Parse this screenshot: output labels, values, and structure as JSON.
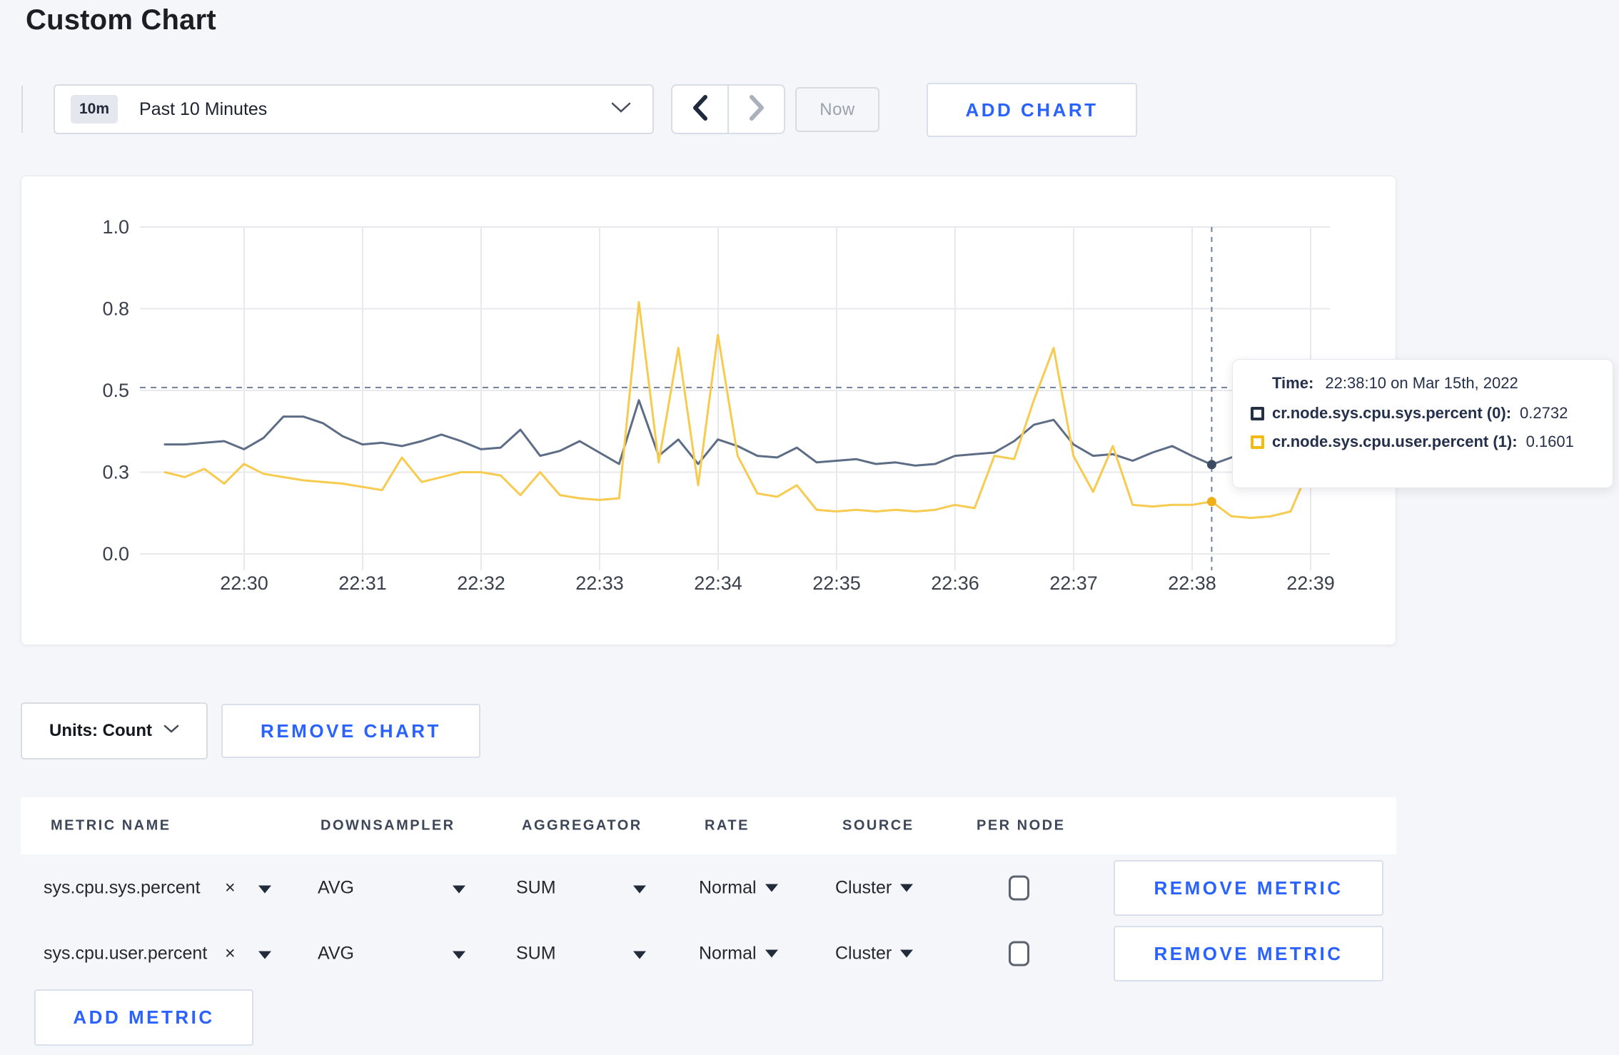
{
  "page": {
    "title": "Custom Chart"
  },
  "toolbar": {
    "time_badge": "10m",
    "time_range_label": "Past 10 Minutes",
    "now_label": "Now",
    "add_chart_label": "ADD CHART"
  },
  "chart_data": {
    "type": "line",
    "title": "",
    "x_start": "22:29:20",
    "x_interval_seconds": 10,
    "x_tick_labels": [
      "22:30",
      "22:31",
      "22:32",
      "22:33",
      "22:34",
      "22:35",
      "22:36",
      "22:37",
      "22:38",
      "22:39"
    ],
    "y_ticks": [
      {
        "label": "0.0",
        "value": 0
      },
      {
        "label": "0.3",
        "value": 0.25
      },
      {
        "label": "0.5",
        "value": 0.5
      },
      {
        "label": "0.8",
        "value": 0.75
      },
      {
        "label": "1.0",
        "value": 1.0
      }
    ],
    "ylim": [
      0,
      1
    ],
    "grid": true,
    "legend_position": "tooltip",
    "series": [
      {
        "name": "cr.node.sys.cpu.sys.percent",
        "color": "#5e6d86",
        "marker_color": "#3d4a63",
        "values": [
          0.335,
          0.335,
          0.34,
          0.345,
          0.32,
          0.355,
          0.42,
          0.42,
          0.4,
          0.36,
          0.335,
          0.34,
          0.33,
          0.345,
          0.365,
          0.345,
          0.32,
          0.325,
          0.38,
          0.3,
          0.315,
          0.345,
          0.31,
          0.275,
          0.47,
          0.3,
          0.35,
          0.275,
          0.35,
          0.33,
          0.3,
          0.295,
          0.325,
          0.28,
          0.285,
          0.29,
          0.275,
          0.28,
          0.27,
          0.275,
          0.3,
          0.305,
          0.31,
          0.345,
          0.395,
          0.41,
          0.335,
          0.3,
          0.305,
          0.285,
          0.31,
          0.33,
          0.3,
          0.2732,
          0.295,
          0.315,
          0.3,
          0.295,
          0.31,
          0.3
        ]
      },
      {
        "name": "cr.node.sys.cpu.user.percent",
        "color": "#f7cb4f",
        "marker_color": "#f0ae1b",
        "values": [
          0.25,
          0.235,
          0.26,
          0.215,
          0.275,
          0.245,
          0.235,
          0.225,
          0.22,
          0.215,
          0.205,
          0.195,
          0.295,
          0.22,
          0.235,
          0.25,
          0.25,
          0.24,
          0.18,
          0.25,
          0.18,
          0.17,
          0.165,
          0.17,
          0.77,
          0.28,
          0.63,
          0.21,
          0.67,
          0.3,
          0.185,
          0.175,
          0.21,
          0.135,
          0.13,
          0.135,
          0.13,
          0.135,
          0.13,
          0.135,
          0.15,
          0.14,
          0.3,
          0.29,
          0.47,
          0.63,
          0.3,
          0.19,
          0.33,
          0.15,
          0.145,
          0.15,
          0.15,
          0.1601,
          0.115,
          0.11,
          0.115,
          0.13,
          0.27,
          0.24
        ]
      }
    ],
    "crosshair": {
      "x_index": 53,
      "x_time": "22:38:10",
      "y_value": 0.509
    }
  },
  "tooltip": {
    "time_label": "Time:",
    "time_value": "22:38:10 on Mar 15th, 2022",
    "rows": [
      {
        "label": "cr.node.sys.cpu.sys.percent (0):",
        "value": "0.2732",
        "color": "#243145"
      },
      {
        "label": "cr.node.sys.cpu.user.percent (1):",
        "value": "0.1601",
        "color": "#f3ba14"
      }
    ]
  },
  "chart_controls": {
    "units_label": "Units: Count",
    "remove_chart_label": "REMOVE CHART"
  },
  "metrics_table": {
    "headers": [
      "METRIC NAME",
      "DOWNSAMPLER",
      "AGGREGATOR",
      "RATE",
      "SOURCE",
      "PER NODE"
    ],
    "remove_tag_icon": "×",
    "rows": [
      {
        "metric_name": "sys.cpu.sys.percent",
        "downsampler": "AVG",
        "aggregator": "SUM",
        "rate": "Normal",
        "source": "Cluster",
        "per_node_checked": false,
        "remove_label": "REMOVE METRIC"
      },
      {
        "metric_name": "sys.cpu.user.percent",
        "downsampler": "AVG",
        "aggregator": "SUM",
        "rate": "Normal",
        "source": "Cluster",
        "per_node_checked": false,
        "remove_label": "REMOVE METRIC"
      }
    ],
    "add_metric_label": "ADD METRIC"
  },
  "colors": {
    "accent_blue": "#2962ff",
    "page_background": "#f5f6f9",
    "grid_line": "#e8e9ed",
    "crosshair": "#6f8098"
  }
}
